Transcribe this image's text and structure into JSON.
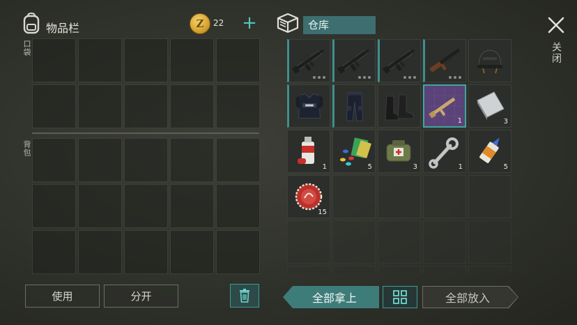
{
  "inventory": {
    "title": "物品栏",
    "coins": "22",
    "pocket_label": "口袋",
    "backpack_label": "背包",
    "pocket_rows": 2,
    "backpack_rows": 3,
    "cols": 5
  },
  "warehouse": {
    "title": "仓库",
    "items": [
      {
        "name": "assault-rifle",
        "qty": "",
        "dots": 3
      },
      {
        "name": "assault-rifle",
        "qty": "",
        "dots": 3
      },
      {
        "name": "assault-rifle",
        "qty": "",
        "dots": 3
      },
      {
        "name": "shotgun",
        "qty": "",
        "dots": 3
      },
      {
        "name": "helmet",
        "qty": ""
      },
      {
        "name": "police-vest",
        "qty": ""
      },
      {
        "name": "tactical-pants",
        "qty": ""
      },
      {
        "name": "combat-boots",
        "qty": ""
      },
      {
        "name": "rifle-blueprint",
        "qty": "1"
      },
      {
        "name": "metal-sheet",
        "qty": "3"
      },
      {
        "name": "spray-paint",
        "qty": "1"
      },
      {
        "name": "colored-pills",
        "qty": "5"
      },
      {
        "name": "medkit-bag",
        "qty": "3"
      },
      {
        "name": "wrench",
        "qty": "1"
      },
      {
        "name": "glue-tube",
        "qty": "5"
      },
      {
        "name": "bottle-cap",
        "qty": "15"
      }
    ]
  },
  "buttons": {
    "use": "使用",
    "split": "分开",
    "take_all": "全部拿上",
    "put_all": "全部放入",
    "close": "关闭"
  },
  "colors": {
    "accent": "#3e7c7a",
    "teal_highlight": "#3ea7a0",
    "blueprint_purple": "#5a4378"
  }
}
